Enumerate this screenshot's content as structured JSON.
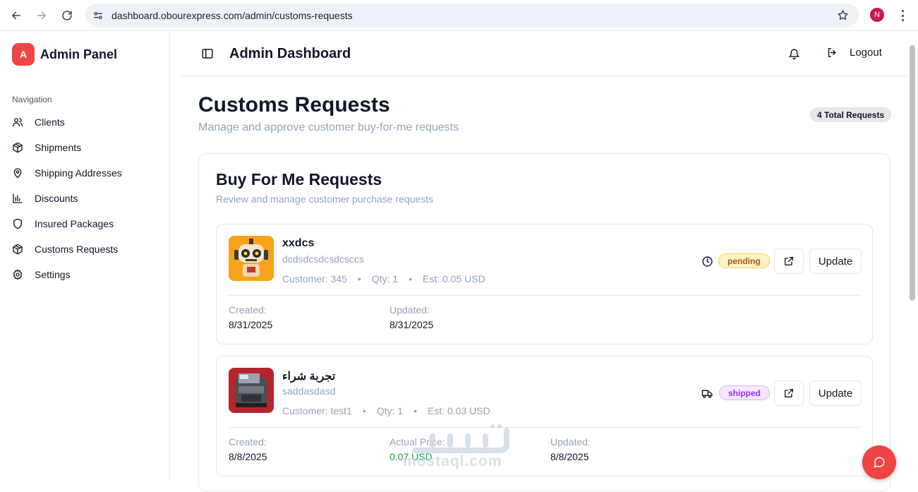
{
  "browser": {
    "url": "dashboard.obourexpress.com/admin/customs-requests",
    "profile_initial": "N"
  },
  "sidebar": {
    "brand_initial": "A",
    "brand_title": "Admin Panel",
    "nav_heading": "Navigation",
    "items": [
      {
        "label": "Clients",
        "icon": "users-icon"
      },
      {
        "label": "Shipments",
        "icon": "package-icon"
      },
      {
        "label": "Shipping Addresses",
        "icon": "map-pin-icon"
      },
      {
        "label": "Discounts",
        "icon": "bar-chart-icon"
      },
      {
        "label": "Insured Packages",
        "icon": "shield-icon"
      },
      {
        "label": "Customs Requests",
        "icon": "package-icon"
      },
      {
        "label": "Settings",
        "icon": "gear-icon"
      }
    ]
  },
  "header": {
    "title": "Admin Dashboard",
    "logout_label": "Logout"
  },
  "page": {
    "title": "Customs Requests",
    "subtitle": "Manage and approve customer buy-for-me requests",
    "total_badge": "4 Total Requests"
  },
  "card": {
    "title": "Buy For Me Requests",
    "subtitle": "Review and manage customer purchase requests"
  },
  "requests": [
    {
      "name": "xxdcs",
      "description": "dcdsdcsdcsdcsccs",
      "customer": "Customer: 345",
      "qty": "Qty: 1",
      "est": "Est: 0.05 USD",
      "status": "pending",
      "status_icon": "clock-icon",
      "update_label": "Update",
      "created_label": "Created:",
      "created": "8/31/2025",
      "updated_label": "Updated:",
      "updated": "8/31/2025"
    },
    {
      "name": "تجربة شراء",
      "description": "saddasdasd",
      "customer": "Customer: test1",
      "qty": "Qty: 1",
      "est": "Est: 0.03 USD",
      "status": "shipped",
      "status_icon": "truck-icon",
      "update_label": "Update",
      "created_label": "Created:",
      "created": "8/8/2025",
      "actual_label": "Actual Price:",
      "actual": "0.07 USD",
      "updated_label": "Updated:",
      "updated": "8/8/2025"
    }
  ],
  "meta_separator": "•",
  "watermark": {
    "text": "mostaql.com"
  },
  "colors": {
    "accent": "#ef4444",
    "pending_bg": "#fef3c7",
    "pending_text": "#b45309",
    "shipped_bg": "#f3e8ff",
    "shipped_text": "#9333ea",
    "price_green": "#16a34a"
  }
}
